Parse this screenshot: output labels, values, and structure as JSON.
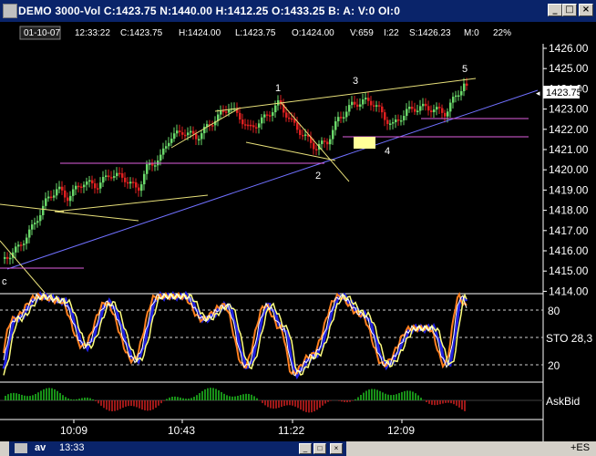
{
  "window": {
    "title": "DEMO 3000-Vol C:1423.75 N:1440.00 H:1412.25 O:1433.25 B: A: V:0 OI:0",
    "buttons": {
      "minimize": "_",
      "maximize": "□",
      "close": "×"
    }
  },
  "info_bar": {
    "date": "01-10-07",
    "time": "12:33:22",
    "close": "C:1423.75",
    "high": "H:1424.00",
    "low": "L:1423.75",
    "open": "O:1424.00",
    "volume": "V:659",
    "interval": "I:22",
    "s": "S:1426.23",
    "m": "M:0",
    "percent": "22%"
  },
  "price_axis": {
    "labels": [
      "1426.00",
      "1425.00",
      "1424.00",
      "1423.00",
      "1422.00",
      "1421.00",
      "1420.00",
      "1419.00",
      "1418.00",
      "1417.00",
      "1416.00",
      "1415.00",
      "1414.00"
    ],
    "current_price": "1423.75"
  },
  "wave_labels": [
    "1",
    "2",
    "3",
    "4",
    "5",
    "c"
  ],
  "stochastic": {
    "label": "STO 28,3",
    "levels": [
      "80",
      "20"
    ]
  },
  "askbid": {
    "label": "AskBid"
  },
  "time_axis": {
    "labels": [
      "10:09",
      "10:43",
      "11:22",
      "12:09"
    ]
  },
  "bottom_window": {
    "title": "av",
    "time": "13:33",
    "symbol": "+ES"
  },
  "colors": {
    "title_bg": "#0a246a",
    "up_bar": "#6ad86a",
    "down_bar": "#e02020",
    "trend_line": "#e8e07a",
    "support_line": "#7070ff",
    "magenta_line": "#e060e0",
    "zone_box": "#ffff99",
    "stoch_blue": "#2020e0",
    "stoch_orange": "#ff8020",
    "stoch_yellow": "#ffff80",
    "stoch_white": "#ffffff"
  }
}
